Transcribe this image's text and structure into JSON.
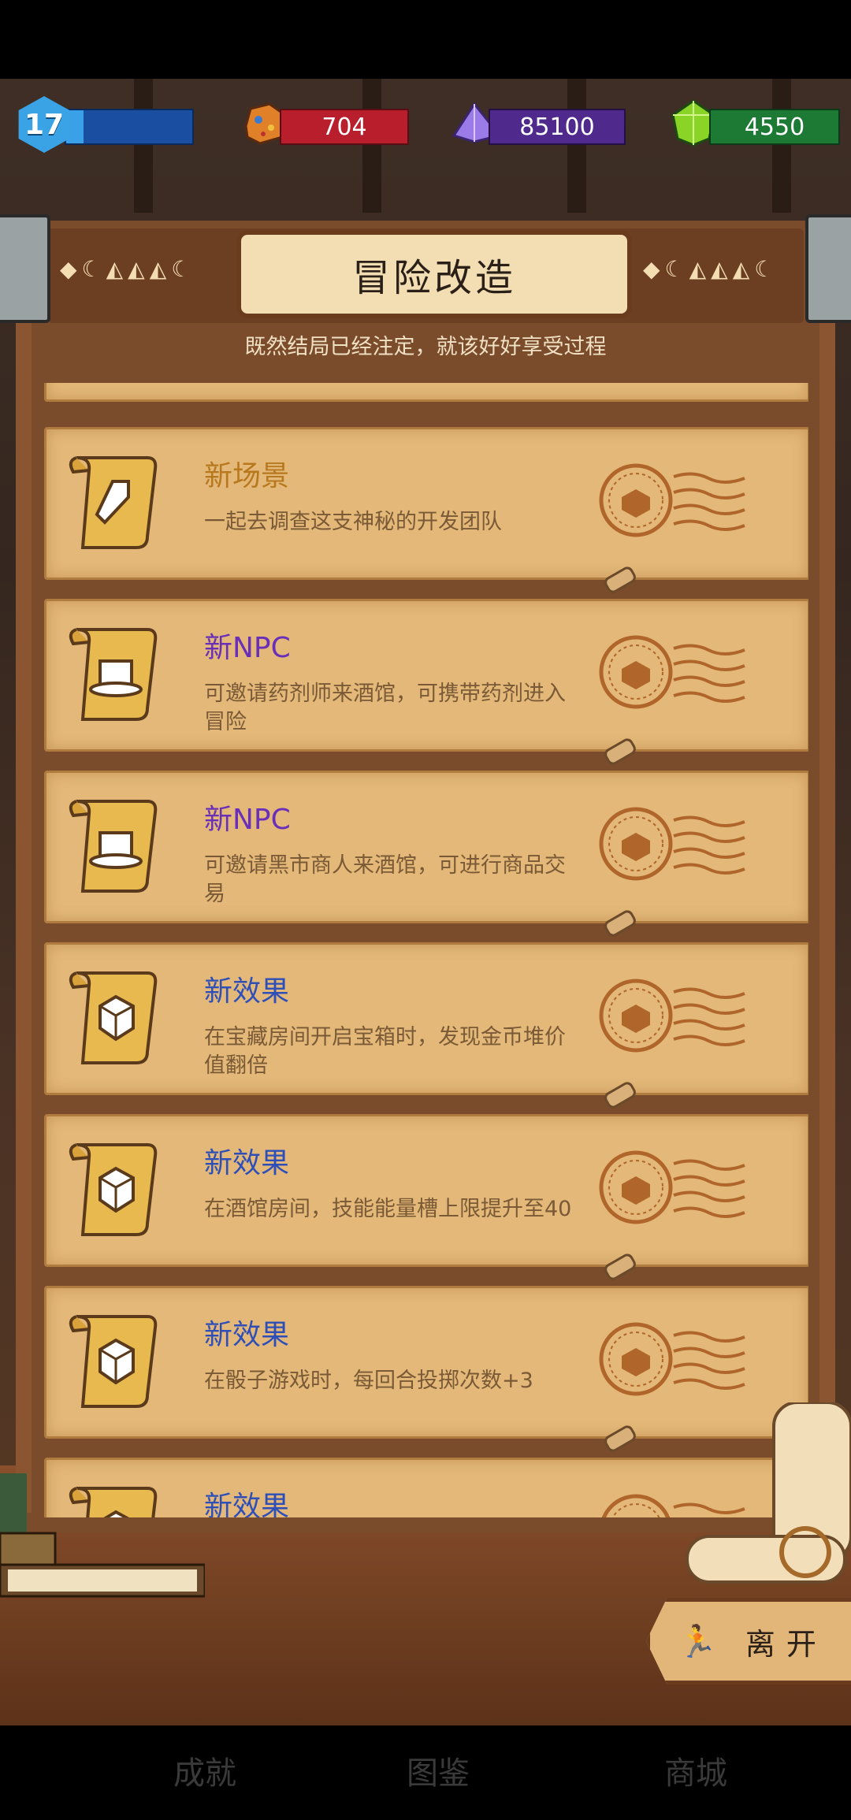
{
  "hud": {
    "level": "17",
    "xp_progress": 0.14,
    "ore": "704",
    "crystal": "85100",
    "gem": "4550",
    "colors": {
      "ore_bar": "#b81e2c",
      "crystal_bar": "#4f2a8c",
      "gem_bar": "#1c7a35",
      "xp_bar": "#1a4ea0"
    }
  },
  "panel": {
    "title": "冒险改造",
    "subtitle": "既然结局已经注定，就该好好享受过程"
  },
  "cards": [
    {
      "title": "新场景",
      "desc": "一起去调查这支神秘的开发团队",
      "color": "#b7781e",
      "icon": "wrench-icon"
    },
    {
      "title": "新NPC",
      "desc": "可邀请药剂师来酒馆，可携带药剂进入冒险",
      "color": "#6a2fb8",
      "icon": "top-hat-icon"
    },
    {
      "title": "新NPC",
      "desc": "可邀请黑市商人来酒馆，可进行商品交易",
      "color": "#6a2fb8",
      "icon": "top-hat-icon"
    },
    {
      "title": "新效果",
      "desc": "在宝藏房间开启宝箱时，发现金币堆价值翻倍",
      "color": "#2f4fb8",
      "icon": "dice-icon"
    },
    {
      "title": "新效果",
      "desc": "在酒馆房间，技能能量槽上限提升至40",
      "color": "#2f4fb8",
      "icon": "dice-icon"
    },
    {
      "title": "新效果",
      "desc": "在骰子游戏时，每回合投掷次数+3",
      "color": "#2f4fb8",
      "icon": "dice-icon"
    },
    {
      "title": "新效果",
      "desc": "",
      "color": "#2f4fb8",
      "icon": "dice-icon"
    }
  ],
  "leave_label": "离开",
  "nav": [
    "成就",
    "图鉴",
    "商城"
  ]
}
